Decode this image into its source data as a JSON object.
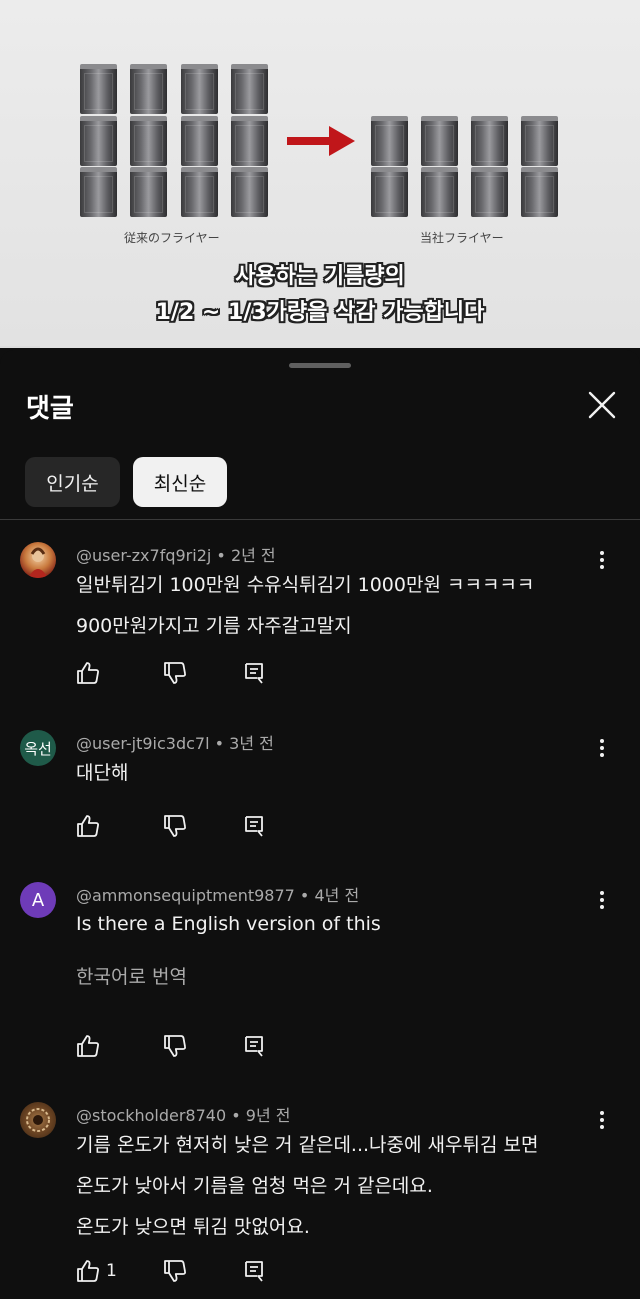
{
  "video": {
    "caption_left": "従来のフライヤー",
    "caption_right": "当社フライヤー",
    "subtitle_line1": "사용하는 기름량의",
    "subtitle_line2": "1/2 ~ 1/3가량을 삭감 가능합니다"
  },
  "panel": {
    "title": "댓글",
    "close_icon": "close-icon",
    "sort_chips": [
      {
        "label": "인기순",
        "selected": false
      },
      {
        "label": "최신순",
        "selected": true
      }
    ]
  },
  "comments": [
    {
      "author": "@user-zx7fq9ri2j",
      "age": "2년 전",
      "lines": [
        "일반튀김기 100만원 수유식튀김기 1000만원 ㅋㅋㅋㅋㅋ",
        "900만원가지고 기름 자주갈고말지"
      ],
      "avatar_initials": "",
      "likes": ""
    },
    {
      "author": "@user-jt9ic3dc7l",
      "age": "3년 전",
      "lines": [
        "대단해"
      ],
      "avatar_initials": "옥선",
      "likes": ""
    },
    {
      "author": "@ammonsequiptment9877",
      "age": "4년 전",
      "lines": [
        "Is there a English version of this"
      ],
      "translate": "한국어로 번역",
      "avatar_initials": "A",
      "likes": ""
    },
    {
      "author": "@stockholder8740",
      "age": "9년 전",
      "lines": [
        "기름 온도가 현저히 낮은 거 같은데...나중에 새우튀김 보면",
        "온도가 낮아서 기름을 엄청 먹은 거 같은데요.",
        "온도가 낮으면 튀김 맛없어요."
      ],
      "avatar_initials": "",
      "likes": "1"
    }
  ],
  "separator": "•",
  "colors": {
    "background": "#0f0f0f",
    "chip_selected": "#f1f1f1",
    "chip_default": "#272727",
    "meta_text": "#aaaaaa",
    "avatar_green": "#1f5a49",
    "avatar_purple": "#6e3bb8",
    "arrow_red": "#c0161a"
  }
}
